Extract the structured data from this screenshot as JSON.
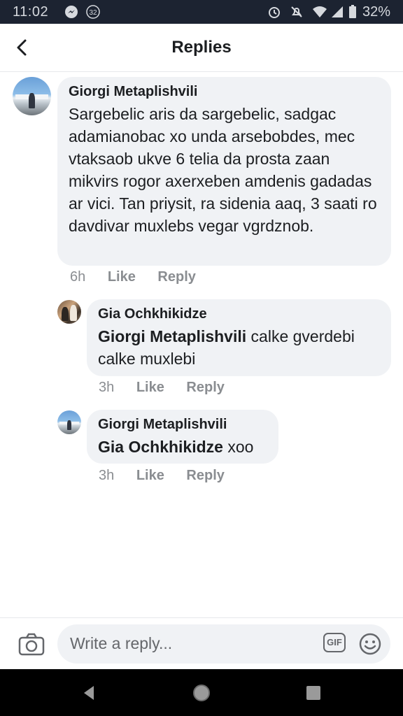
{
  "status_bar": {
    "time": "11:02",
    "notification_count": "32",
    "battery": "32%"
  },
  "header": {
    "title": "Replies"
  },
  "comments": [
    {
      "author": "Giorgi Metaplishvili",
      "text": "Sargebelic aris da sargebelic, sadgac adamianobac xo unda arsebobdes, mec vtaksaob ukve 6 telia da prosta zaan mikvirs rogor axerxeben amdenis gadadas ar vici. Tan priysit, ra sidenia aaq, 3 saati ro davdivar muxlebs vegar vgrdznob.",
      "time": "6h",
      "like": "Like",
      "reply": "Reply"
    },
    {
      "author": "Gia Ochkhikidze",
      "mention": "Giorgi Metaplishvili",
      "text": " calke gverdebi calke muxlebi",
      "time": "3h",
      "like": "Like",
      "reply": "Reply"
    },
    {
      "author": "Giorgi Metaplishvili",
      "mention": "Gia Ochkhikidze",
      "text": " xoo",
      "time": "3h",
      "like": "Like",
      "reply": "Reply"
    }
  ],
  "composer": {
    "placeholder": "Write a reply...",
    "gif_label": "GIF"
  },
  "colors": {
    "status_bar_bg": "#1c2331",
    "bubble_bg": "#f0f2f5",
    "meta_text": "#8a8d91",
    "nav_bar_bg": "#000000"
  },
  "icons": [
    "messenger-icon",
    "notification-badge-icon",
    "alarm-icon",
    "mute-icon",
    "wifi-icon",
    "signal-icon",
    "battery-icon",
    "back-arrow-icon",
    "camera-icon",
    "gif-icon",
    "emoji-icon",
    "nav-back-icon",
    "nav-home-icon",
    "nav-recents-icon"
  ]
}
